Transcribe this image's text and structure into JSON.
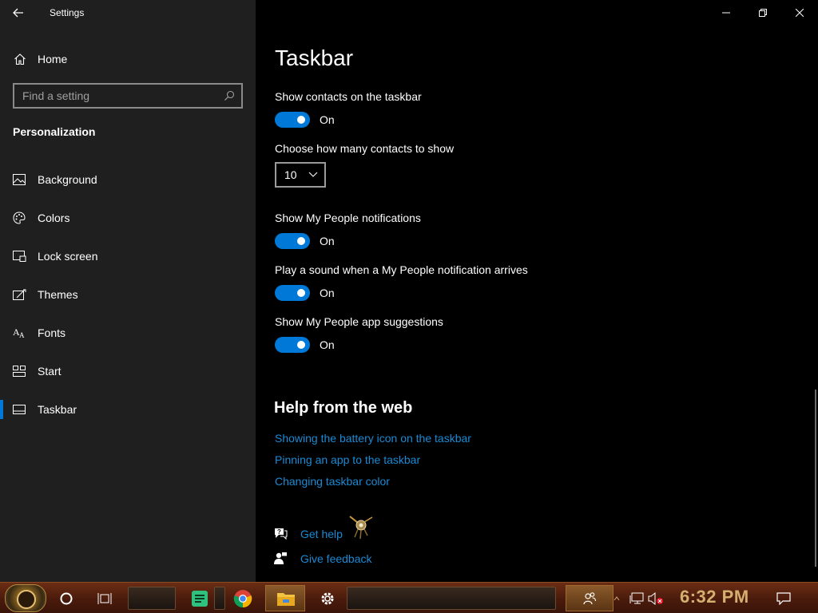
{
  "window": {
    "app_title": "Settings",
    "back_icon": "arrow-left-icon",
    "minimize_icon": "minimize-icon",
    "restore_icon": "restore-icon",
    "close_icon": "close-icon"
  },
  "sidebar": {
    "home_label": "Home",
    "search_placeholder": "Find a setting",
    "section_heading": "Personalization",
    "items": [
      {
        "label": "Background",
        "icon": "picture-icon"
      },
      {
        "label": "Colors",
        "icon": "palette-icon"
      },
      {
        "label": "Lock screen",
        "icon": "lock-screen-icon"
      },
      {
        "label": "Themes",
        "icon": "themes-icon"
      },
      {
        "label": "Fonts",
        "icon": "fonts-icon"
      },
      {
        "label": "Start",
        "icon": "start-icon"
      },
      {
        "label": "Taskbar",
        "icon": "taskbar-icon"
      }
    ],
    "active_item": "Taskbar"
  },
  "main": {
    "page_title": "Taskbar",
    "show_contacts": {
      "label": "Show contacts on the taskbar",
      "state": "On"
    },
    "contacts_count": {
      "label": "Choose how many contacts to show",
      "value": "10"
    },
    "people_notifications": {
      "label": "Show My People notifications",
      "state": "On"
    },
    "play_sound": {
      "label": "Play a sound when a My People notification arrives",
      "state": "On"
    },
    "app_suggestions": {
      "label": "Show My People app suggestions",
      "state": "On"
    },
    "help_heading": "Help from the web",
    "help_links": [
      "Showing the battery icon on the taskbar",
      "Pinning an app to the taskbar",
      "Changing taskbar color"
    ],
    "get_help": "Get help",
    "give_feedback": "Give feedback"
  },
  "taskbar": {
    "clock": "6:32 PM",
    "apps": [
      "cortana-icon",
      "task-view-icon",
      "notes-app-icon",
      "chrome-icon",
      "file-explorer-icon",
      "settings-gear-icon",
      "people-icon"
    ],
    "tray": [
      "network-icon",
      "volume-muted-icon",
      "action-center-icon"
    ],
    "colors": {
      "accent": "#0078d7",
      "link": "#1a8ad4",
      "clock": "#d4b070"
    }
  }
}
